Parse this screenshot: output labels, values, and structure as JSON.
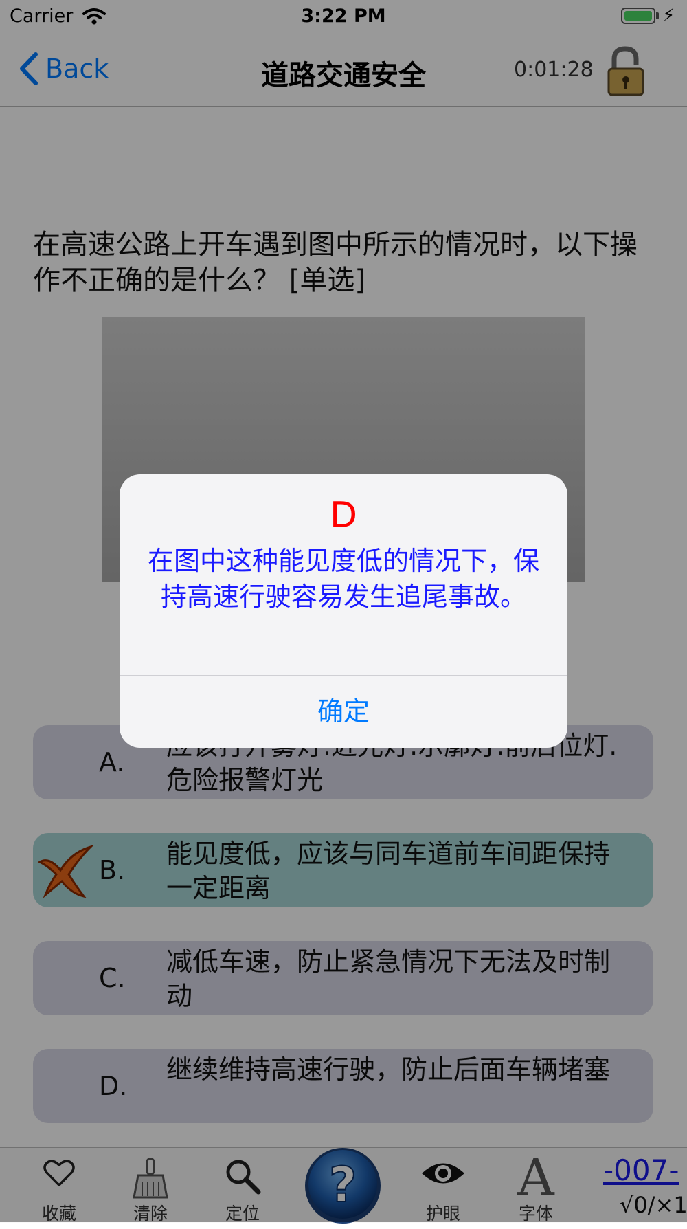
{
  "status_bar": {
    "carrier": "Carrier",
    "time": "3:22 PM"
  },
  "nav": {
    "back_label": "Back",
    "title": "道路交通安全",
    "timer": "0:01:28"
  },
  "question": {
    "text": "在高速公路上开车遇到图中所示的情况时，以下操作不正确的是什么？ [单选]"
  },
  "options": [
    {
      "letter": "A.",
      "text": "应该打开雾灯.近光灯.示廓灯.前后位灯.危险报警灯光"
    },
    {
      "letter": "B.",
      "text": "能见度低，应该与同车道前车间距保持一定距离",
      "state": "wrong"
    },
    {
      "letter": "C.",
      "text": "减低车速，防止紧急情况下无法及时制动"
    },
    {
      "letter": "D.",
      "text": "继续维持高速行驶，防止后面车辆堵塞"
    }
  ],
  "alert": {
    "title": "D",
    "message": "在图中这种能见度低的情况下，保持高速行驶容易发生追尾事故。",
    "button": "确定"
  },
  "tab_bar": {
    "favorite": "收藏",
    "clear": "清除",
    "locate": "定位",
    "eye_care": "护眼",
    "font": "字体",
    "page": "-007-",
    "score": "√0/×1"
  },
  "colors": {
    "accent": "#007aff",
    "alert_title": "#ff0000",
    "alert_message": "#1a1aff",
    "option_bg": "#d8d8e6",
    "wrong_option_bg": "#a7d6d6"
  },
  "icons": [
    "wifi-icon",
    "back-chevron-icon",
    "lock-icon",
    "wrong-mark-icon",
    "heart-icon",
    "broom-icon",
    "magnifier-icon",
    "help-icon",
    "eye-icon",
    "font-icon"
  ]
}
